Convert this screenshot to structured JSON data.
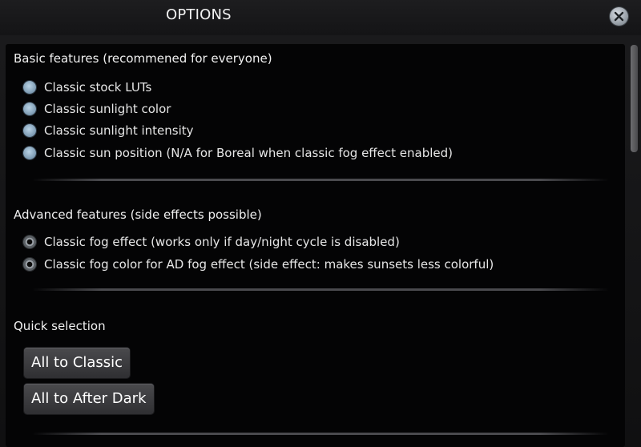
{
  "window": {
    "title": "OPTIONS",
    "close_icon": "close-icon"
  },
  "basic": {
    "title": "Basic features (recommened for everyone)",
    "options": [
      {
        "label": "Classic stock LUTs",
        "checked": true
      },
      {
        "label": "Classic sunlight color",
        "checked": true
      },
      {
        "label": "Classic sunlight intensity",
        "checked": true
      },
      {
        "label": "Classic sun position (N/A for Boreal when classic fog effect enabled)",
        "checked": true
      }
    ]
  },
  "advanced": {
    "title": "Advanced features (side effects possible)",
    "options": [
      {
        "label": "Classic fog effect (works only if day/night cycle is disabled)",
        "checked": false
      },
      {
        "label": "Classic fog color for AD fog effect (side effect: makes sunsets less colorful)",
        "checked": false
      }
    ]
  },
  "quick": {
    "title": "Quick selection",
    "buttons": [
      {
        "label": "All to Classic"
      },
      {
        "label": "All to After Dark"
      }
    ]
  },
  "colors": {
    "accent": "#9fbfd8",
    "background": "#040405",
    "button": "#3c3c3f"
  }
}
